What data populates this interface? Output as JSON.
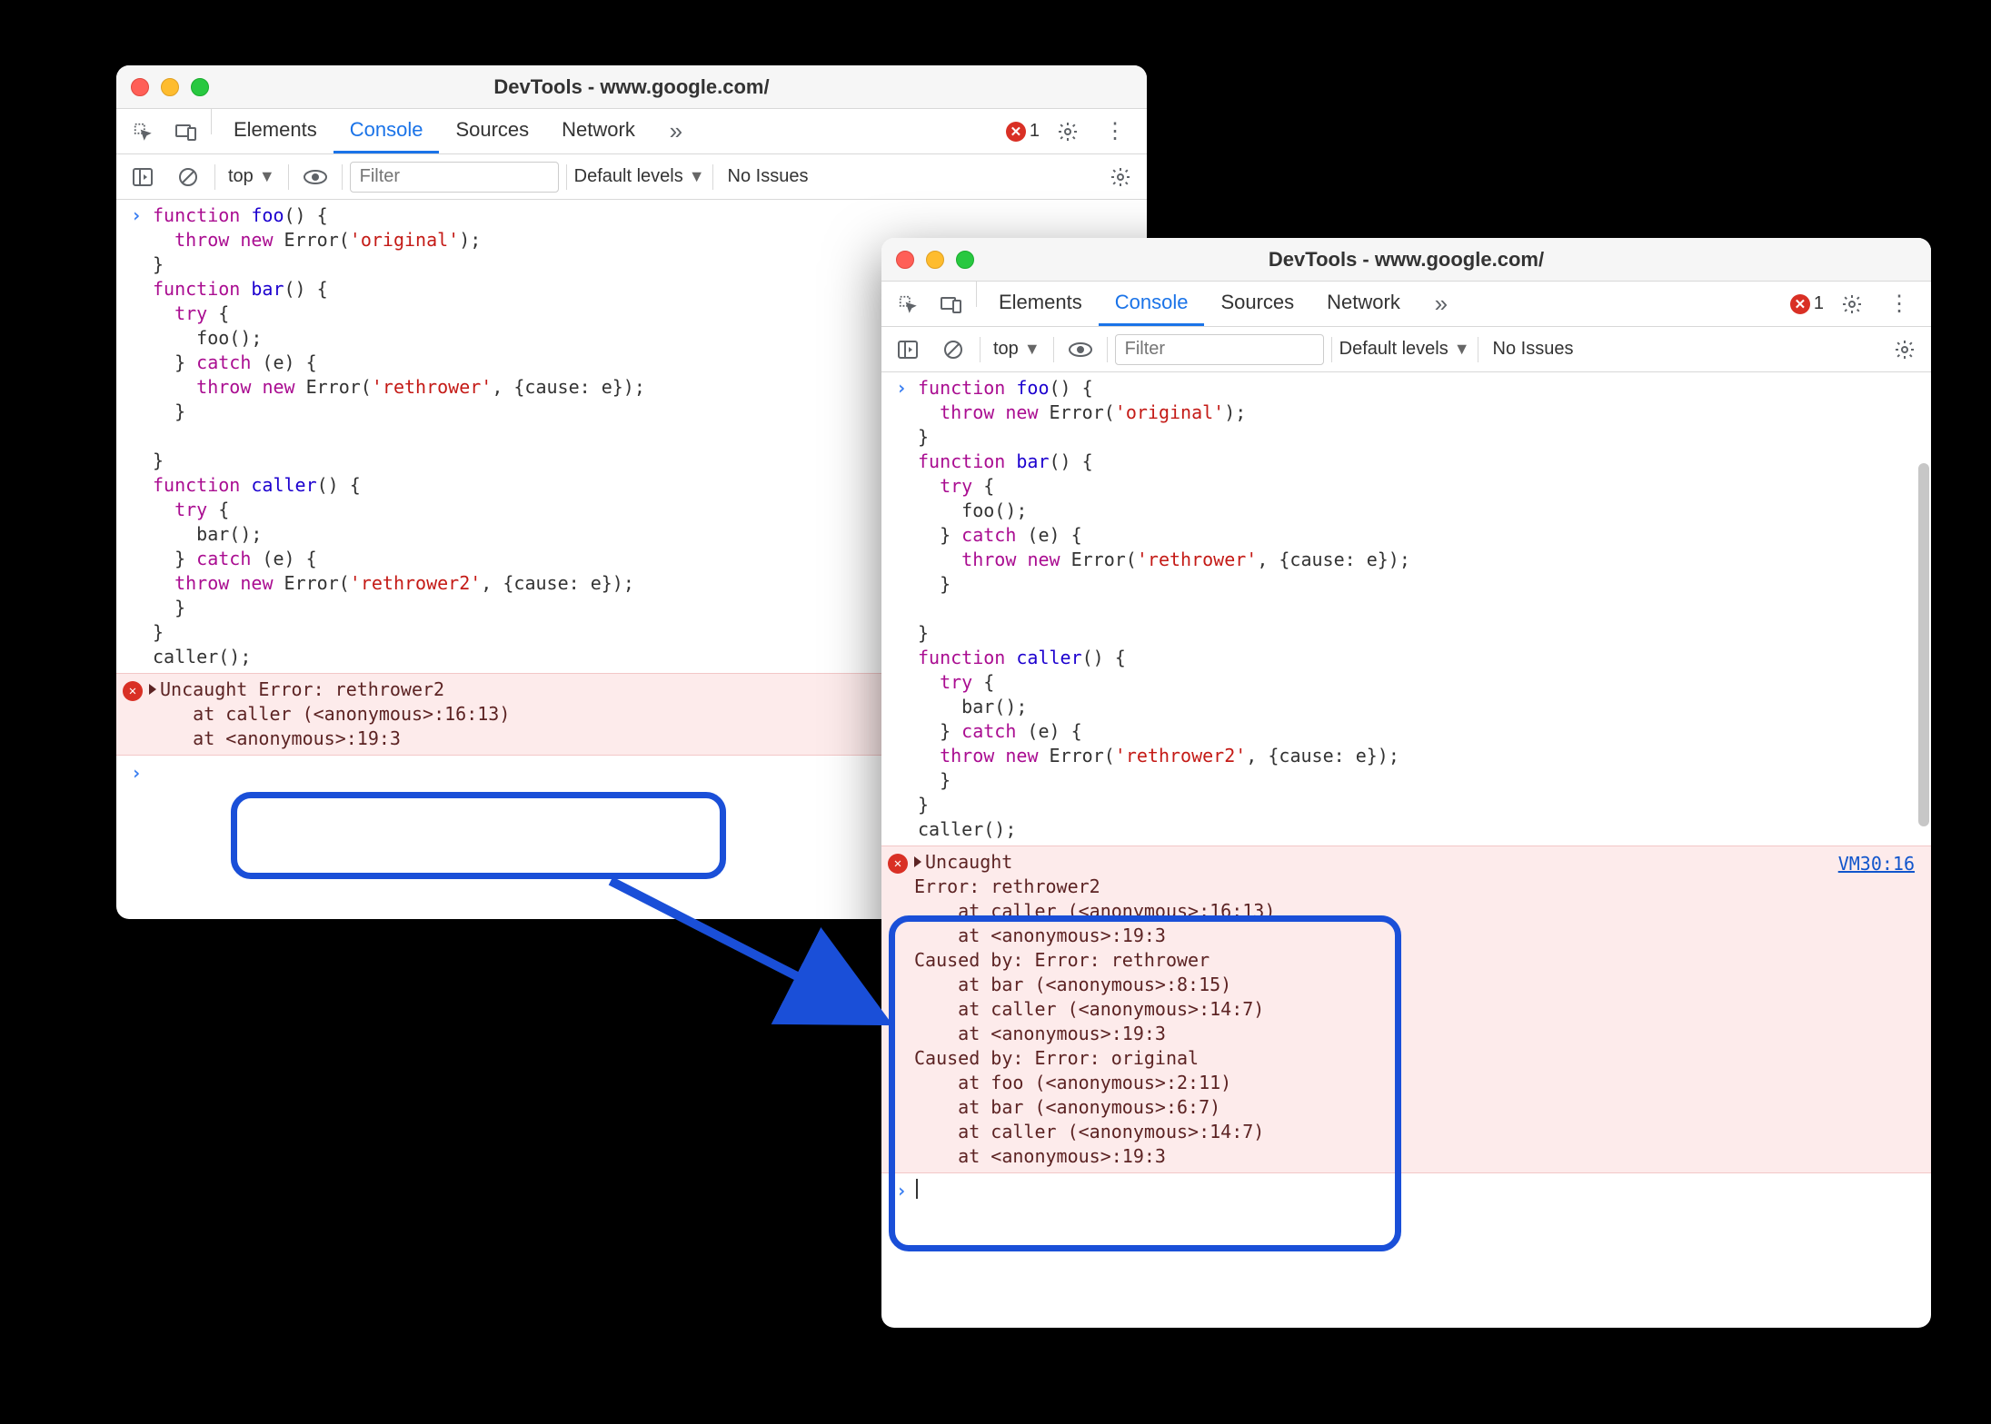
{
  "window1": {
    "title": "DevTools - www.google.com/",
    "tabs": [
      "Elements",
      "Console",
      "Sources",
      "Network"
    ],
    "active_tab": "Console",
    "error_count": "1",
    "context": "top",
    "filter_placeholder": "Filter",
    "levels": "Default levels",
    "issues": "No Issues",
    "code_lines": [
      [
        {
          "t": "kw",
          "s": "function"
        },
        {
          "t": "plain",
          "s": " "
        },
        {
          "t": "fn",
          "s": "foo"
        },
        {
          "t": "plain",
          "s": "() {"
        }
      ],
      [
        {
          "t": "plain",
          "s": "  "
        },
        {
          "t": "kw",
          "s": "throw"
        },
        {
          "t": "plain",
          "s": " "
        },
        {
          "t": "kw",
          "s": "new"
        },
        {
          "t": "plain",
          "s": " Error("
        },
        {
          "t": "str",
          "s": "'original'"
        },
        {
          "t": "plain",
          "s": ");"
        }
      ],
      [
        {
          "t": "plain",
          "s": "}"
        }
      ],
      [
        {
          "t": "kw",
          "s": "function"
        },
        {
          "t": "plain",
          "s": " "
        },
        {
          "t": "fn",
          "s": "bar"
        },
        {
          "t": "plain",
          "s": "() {"
        }
      ],
      [
        {
          "t": "plain",
          "s": "  "
        },
        {
          "t": "kw",
          "s": "try"
        },
        {
          "t": "plain",
          "s": " {"
        }
      ],
      [
        {
          "t": "plain",
          "s": "    foo();"
        }
      ],
      [
        {
          "t": "plain",
          "s": "  } "
        },
        {
          "t": "kw",
          "s": "catch"
        },
        {
          "t": "plain",
          "s": " (e) {"
        }
      ],
      [
        {
          "t": "plain",
          "s": "    "
        },
        {
          "t": "kw",
          "s": "throw"
        },
        {
          "t": "plain",
          "s": " "
        },
        {
          "t": "kw",
          "s": "new"
        },
        {
          "t": "plain",
          "s": " Error("
        },
        {
          "t": "str",
          "s": "'rethrower'"
        },
        {
          "t": "plain",
          "s": ", {cause: e});"
        }
      ],
      [
        {
          "t": "plain",
          "s": "  }"
        }
      ],
      [
        {
          "t": "plain",
          "s": ""
        }
      ],
      [
        {
          "t": "plain",
          "s": "}"
        }
      ],
      [
        {
          "t": "kw",
          "s": "function"
        },
        {
          "t": "plain",
          "s": " "
        },
        {
          "t": "fn",
          "s": "caller"
        },
        {
          "t": "plain",
          "s": "() {"
        }
      ],
      [
        {
          "t": "plain",
          "s": "  "
        },
        {
          "t": "kw",
          "s": "try"
        },
        {
          "t": "plain",
          "s": " {"
        }
      ],
      [
        {
          "t": "plain",
          "s": "    bar();"
        }
      ],
      [
        {
          "t": "plain",
          "s": "  } "
        },
        {
          "t": "kw",
          "s": "catch"
        },
        {
          "t": "plain",
          "s": " (e) {"
        }
      ],
      [
        {
          "t": "plain",
          "s": "  "
        },
        {
          "t": "kw",
          "s": "throw"
        },
        {
          "t": "plain",
          "s": " "
        },
        {
          "t": "kw",
          "s": "new"
        },
        {
          "t": "plain",
          "s": " Error("
        },
        {
          "t": "str",
          "s": "'rethrower2'"
        },
        {
          "t": "plain",
          "s": ", {cause: e});"
        }
      ],
      [
        {
          "t": "plain",
          "s": "  }"
        }
      ],
      [
        {
          "t": "plain",
          "s": "}"
        }
      ],
      [
        {
          "t": "plain",
          "s": "caller();"
        }
      ]
    ],
    "error_text": "Uncaught Error: rethrower2\n    at caller (<anonymous>:16:13)\n    at <anonymous>:19:3"
  },
  "window2": {
    "title": "DevTools - www.google.com/",
    "tabs": [
      "Elements",
      "Console",
      "Sources",
      "Network"
    ],
    "active_tab": "Console",
    "error_count": "1",
    "context": "top",
    "filter_placeholder": "Filter",
    "levels": "Default levels",
    "issues": "No Issues",
    "error_link": "VM30:16",
    "error_text": "Uncaught \nError: rethrower2\n    at caller (<anonymous>:16:13)\n    at <anonymous>:19:3\nCaused by: Error: rethrower\n    at bar (<anonymous>:8:15)\n    at caller (<anonymous>:14:7)\n    at <anonymous>:19:3\nCaused by: Error: original\n    at foo (<anonymous>:2:11)\n    at bar (<anonymous>:6:7)\n    at caller (<anonymous>:14:7)\n    at <anonymous>:19:3"
  }
}
